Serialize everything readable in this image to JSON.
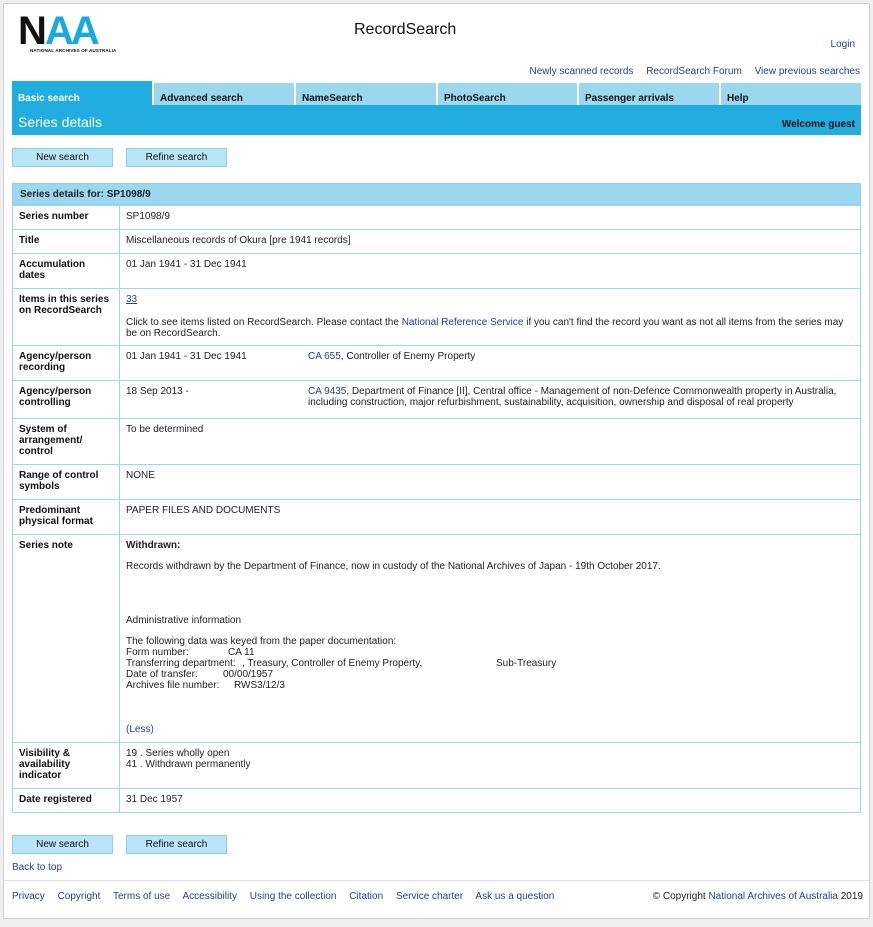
{
  "header": {
    "logo_text": "NAA",
    "logo_sub": "NATIONAL ARCHIVES OF AUSTRALIA",
    "app_title": "RecordSearch",
    "login": "Login",
    "links": [
      "Newly scanned records",
      "RecordSearch Forum",
      "View previous searches"
    ]
  },
  "tabs": [
    "Basic search",
    "Advanced search",
    "NameSearch",
    "PhotoSearch",
    "Passenger arrivals",
    "Help"
  ],
  "bar": {
    "title": "Series details",
    "welcome": "Welcome guest"
  },
  "buttons": {
    "new_search": "New search",
    "refine_search": "Refine search"
  },
  "details": {
    "head_label": "Series details for:",
    "head_value": "SP1098/9",
    "rows": {
      "series_number": {
        "label": "Series number",
        "value": "SP1098/9"
      },
      "title": {
        "label": "Title",
        "value": "Miscellaneous records of Okura [pre 1941 records]"
      },
      "accumulation": {
        "label": "Accumulation dates",
        "value": "01 Jan 1941 - 31 Dec 1941"
      },
      "items": {
        "label": "Items in this series on RecordSearch",
        "count": "33",
        "text_before": "Click to see items listed on RecordSearch. Please contact the ",
        "link": "National Reference Service",
        "text_after": " if you can't find the record you want as not all items from the series may be on RecordSearch."
      },
      "recording": {
        "label": "Agency/person recording",
        "date": "01 Jan 1941 - 31 Dec 1941",
        "agency_id": "CA 655",
        "agency_name": ", Controller of Enemy Property"
      },
      "controlling": {
        "label": "Agency/person controlling",
        "date": "18 Sep 2013 -",
        "agency_id": "CA 9435",
        "agency_name": ", Department of Finance [II], Central office - Management of non-Defence Commonwealth property in Australia, including construction, major refurbishment, sustainability, acquisition, ownership and disposal of real property"
      },
      "system": {
        "label": "System of arrangement/ control",
        "value": "To be determined"
      },
      "range": {
        "label": "Range of control symbols",
        "value": "NONE"
      },
      "format": {
        "label": "Predominant physical format",
        "value": "PAPER FILES AND DOCUMENTS"
      },
      "note": {
        "label": "Series note",
        "heading": "Withdrawn:",
        "para": "Records withdrawn by the Department of Finance, now in custody of the National Archives of Japan - 19th October 2017.",
        "admin_title": "Administrative information",
        "admin_intro": "The following data was keyed from the paper documentation:",
        "form_label": "Form number:",
        "form_value": "CA 11",
        "transfer_label": "Transferring department:",
        "transfer_value": ", Treasury, Controller of Enemy Property,",
        "transfer_extra": "Sub-Treasury",
        "date_label": "Date of transfer:",
        "date_value": "00/00/1957",
        "file_label": "Archives file number:",
        "file_value": "RWS3/12/3",
        "less": "(Less)"
      },
      "visibility": {
        "label": "Visibility & availability indicator",
        "line1": "19 . Series wholly open",
        "line2": "41 . Withdrawn permanently"
      },
      "registered": {
        "label": "Date registered",
        "value": "31 Dec 1957"
      }
    }
  },
  "back_to_top": "Back to top",
  "footer": {
    "links": [
      "Privacy",
      "Copyright",
      "Terms of use",
      "Accessibility",
      "Using the collection",
      "Citation",
      "Service charter",
      "Ask us a question"
    ],
    "copyright_prefix": "© Copyright ",
    "copyright_org": "National Archives of Australia",
    "copyright_year": " 2019"
  },
  "colors": {
    "accent": "#21ade0",
    "light": "#9bd8ef",
    "button": "#b9e6f7",
    "link": "#1f3f99"
  }
}
